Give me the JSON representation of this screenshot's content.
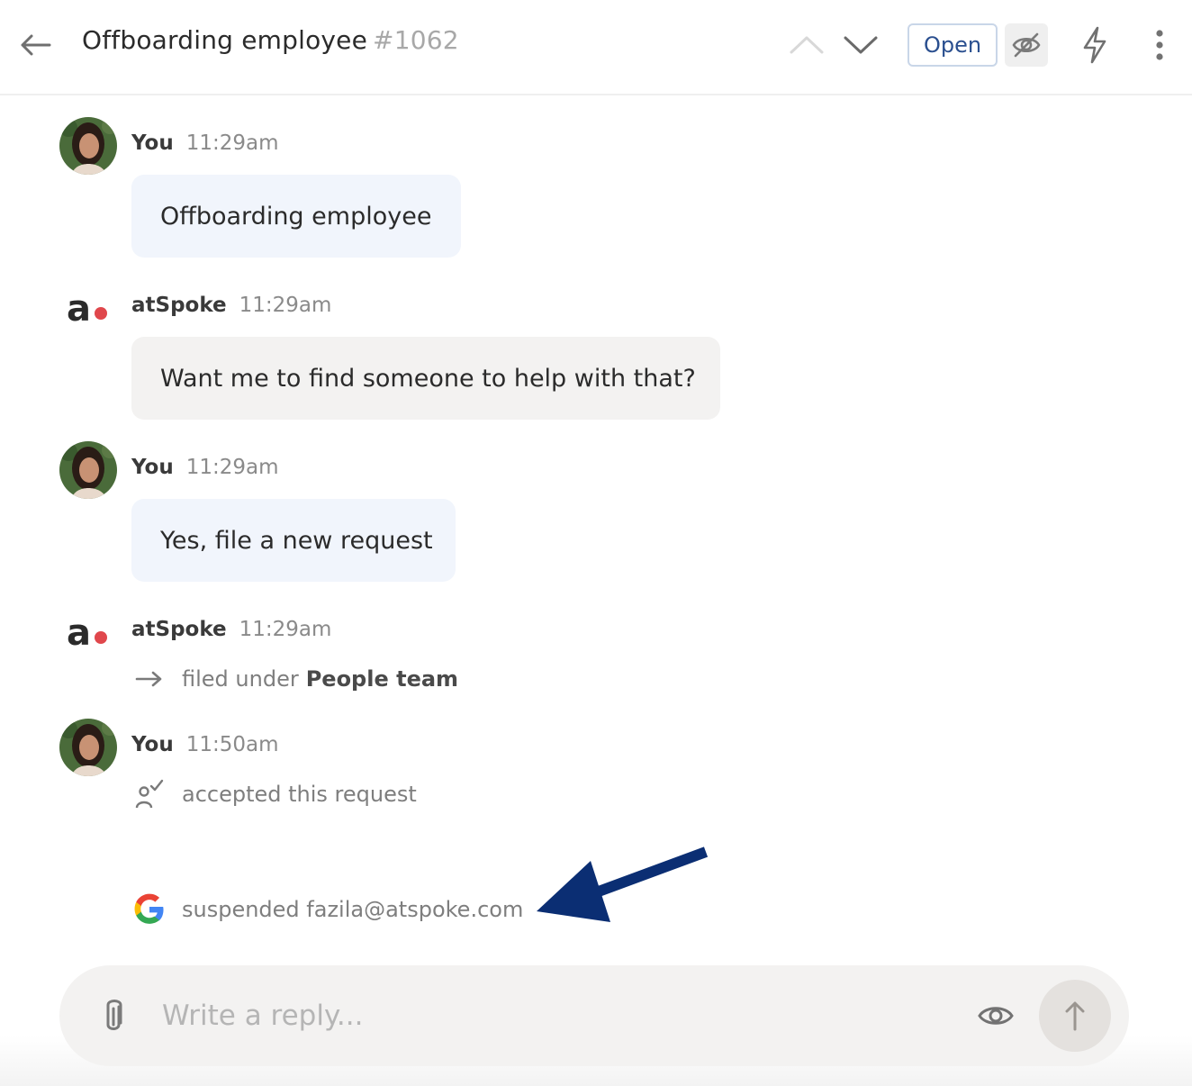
{
  "header": {
    "back_icon": "arrow-left-icon",
    "title": "Offboarding employee",
    "ticket_number": "#1062",
    "status_label": "Open",
    "icons": [
      "chevron-up-icon",
      "chevron-down-icon",
      "eye-off-icon",
      "lightning-icon",
      "more-vertical-icon"
    ]
  },
  "messages": [
    {
      "author": "You",
      "time": "11:29am",
      "text": "Offboarding employee"
    },
    {
      "author": "atSpoke",
      "time": "11:29am",
      "text": "Want me to find someone to help with that?"
    },
    {
      "author": "You",
      "time": "11:29am",
      "text": "Yes, file a new request"
    },
    {
      "author": "atSpoke",
      "time": "11:29am",
      "event_prefix": "filed under",
      "event_bold": "People team"
    },
    {
      "author": "You",
      "time": "11:50am",
      "event_text": "accepted this request"
    }
  ],
  "google_event": {
    "text": "suspended fazila@atspoke.com"
  },
  "composer": {
    "placeholder": "Write a reply..."
  },
  "colors": {
    "accent_blue": "#2a4f8f",
    "annotation_arrow": "#0b2e73",
    "bot_red": "#e0474c",
    "user_bubble": "#f1f5fc",
    "bot_bubble": "#f3f2f1"
  }
}
